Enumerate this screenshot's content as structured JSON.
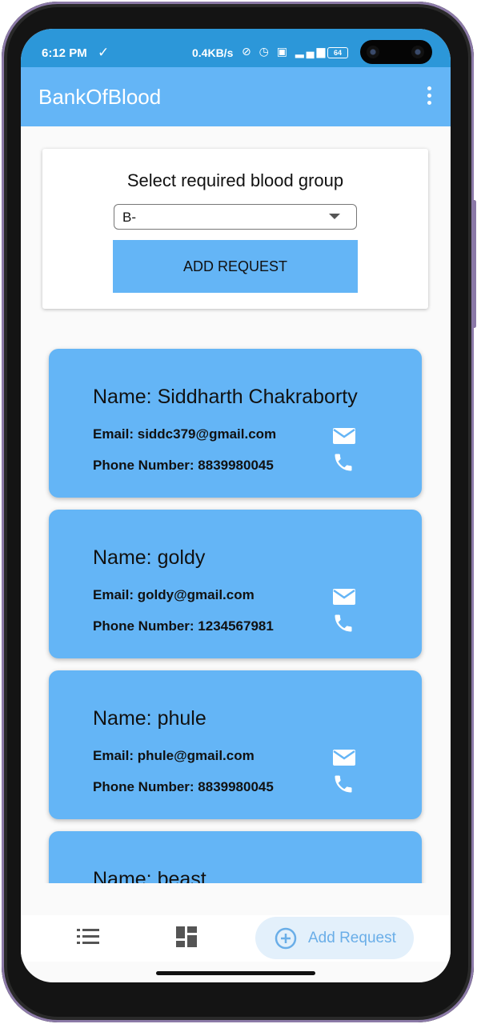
{
  "status_bar": {
    "time": "6:12 PM",
    "speed": "0.4KB/s",
    "battery": "64"
  },
  "app_bar": {
    "title": "BankOfBlood"
  },
  "request_form": {
    "label": "Select required blood group",
    "selected_group": "B-",
    "button_label": "ADD REQUEST"
  },
  "donors": [
    {
      "name": "Name: Siddharth Chakraborty",
      "email": "Email: siddc379@gmail.com",
      "phone": "Phone Number: 8839980045"
    },
    {
      "name": "Name: goldy",
      "email": "Email: goldy@gmail.com",
      "phone": "Phone Number: 1234567981"
    },
    {
      "name": "Name: phule",
      "email": "Email: phule@gmail.com",
      "phone": "Phone Number: 8839980045"
    },
    {
      "name": "Name: beast",
      "email": "",
      "phone": ""
    }
  ],
  "bottom_nav": {
    "add_request_label": "Add Request"
  },
  "colors": {
    "status_bar": "#2c97d9",
    "primary": "#64b5f6",
    "nav_pill_bg": "#e3f0fb",
    "nav_pill_text": "#6aaee8"
  },
  "icons": [
    "check-icon",
    "more-vert-icon",
    "email-icon",
    "phone-icon",
    "list-icon",
    "dashboard-icon",
    "add-circle-icon"
  ]
}
